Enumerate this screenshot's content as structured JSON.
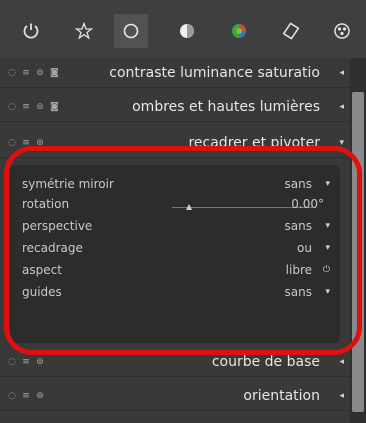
{
  "toolbar": {
    "icons": [
      "power-icon",
      "star-icon",
      "circle-icon",
      "half-circle-icon",
      "color-circle-icon",
      "shape-icon",
      "ball-icon"
    ]
  },
  "modules": [
    {
      "label": "contraste luminance saturatio",
      "arrow": "◂"
    },
    {
      "label": "ombres et hautes lumières",
      "arrow": "◂"
    },
    {
      "label": "recadrer et pivoter",
      "arrow": "▾"
    },
    {
      "label": "courbe de base",
      "arrow": "◂"
    },
    {
      "label": "orientation",
      "arrow": "◂"
    }
  ],
  "params": [
    {
      "label": "symétrie miroir",
      "value": "sans",
      "control": "▾"
    },
    {
      "label": "rotation",
      "value": "0.00°",
      "control": ""
    },
    {
      "label": "perspective",
      "value": "sans",
      "control": "▾"
    },
    {
      "label": "recadrage",
      "value": "ou",
      "control": "▾"
    },
    {
      "label": "aspect",
      "value": "libre",
      "control": "⏻"
    },
    {
      "label": "guides",
      "value": "sans",
      "control": "▾"
    }
  ],
  "colors": {
    "highlight": "#e01010"
  }
}
